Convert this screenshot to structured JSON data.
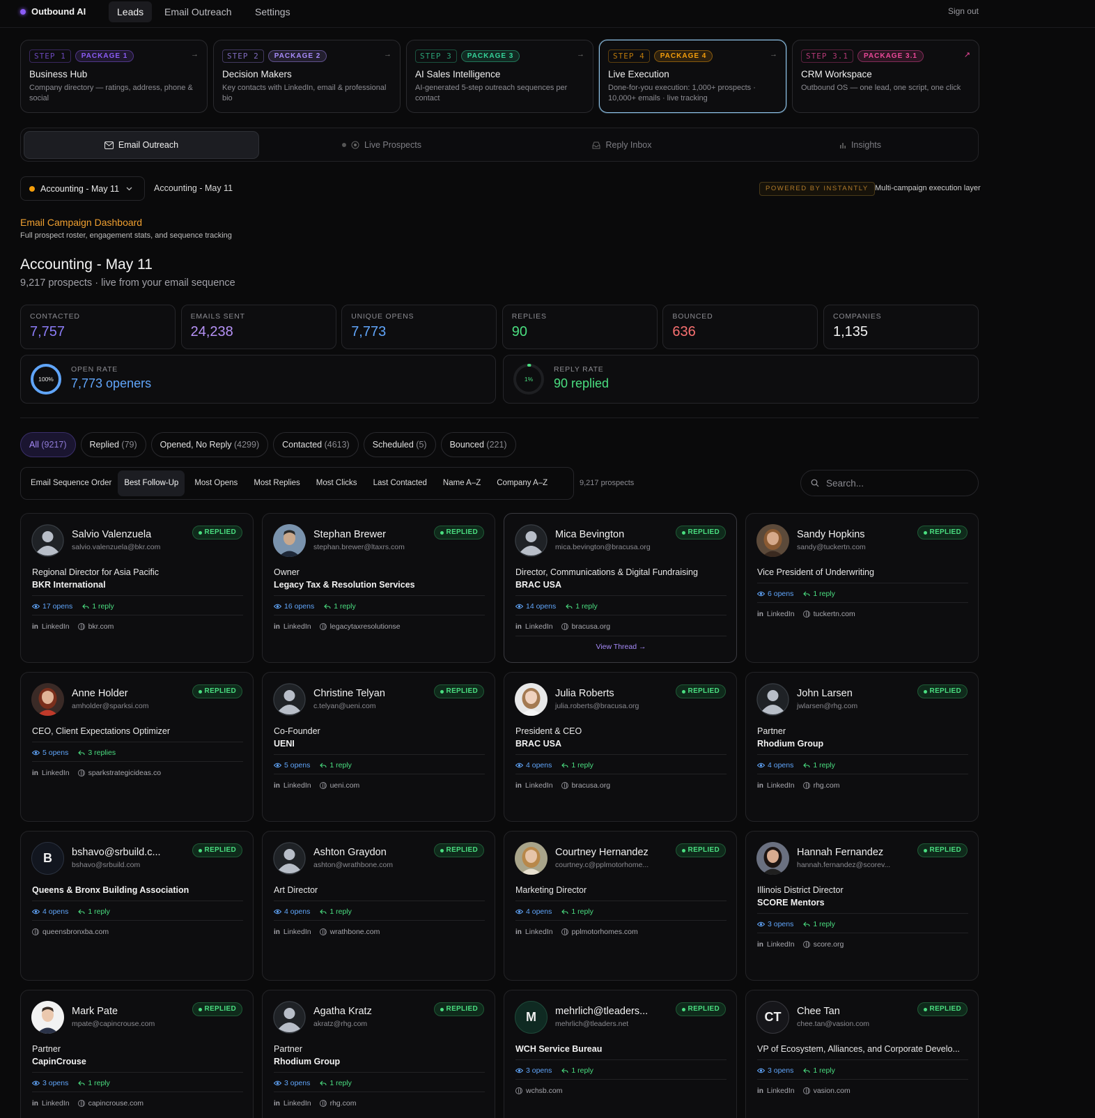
{
  "app": {
    "brand": "Outbound AI",
    "nav": [
      "Leads",
      "Email Outreach",
      "Settings"
    ],
    "sign_out": "Sign out"
  },
  "steps": [
    {
      "step": "STEP 1",
      "package": "PACKAGE 1",
      "title": "Business Hub",
      "desc": "Company directory — ratings, address, phone & social",
      "arrow": "→",
      "color": "#8b5cf6"
    },
    {
      "step": "STEP 2",
      "package": "PACKAGE 2",
      "title": "Decision Makers",
      "desc": "Key contacts with LinkedIn, email & professional bio",
      "arrow": "→",
      "color": "#a78bfa"
    },
    {
      "step": "STEP 3",
      "package": "PACKAGE 3",
      "title": "AI Sales Intelligence",
      "desc": "AI-generated 5-step outreach sequences per contact",
      "arrow": "→",
      "color": "#34d399"
    },
    {
      "step": "STEP 4",
      "package": "PACKAGE 4",
      "title": "Live Execution",
      "desc": "Done-for-you execution: 1,000+ prospects · 10,000+ emails · live tracking",
      "arrow": "→",
      "color": "#f59e0b"
    },
    {
      "step": "STEP 3.1",
      "package": "PACKAGE 3.1",
      "title": "CRM Workspace",
      "desc": "Outbound OS — one lead, one script, one click",
      "arrow": "↗",
      "color": "#ec4899"
    }
  ],
  "subtabs": [
    "Email Outreach",
    "Live Prospects",
    "Reply Inbox",
    "Insights"
  ],
  "campaign": {
    "selected": "Accounting - May 11",
    "label": "Accounting - May 11",
    "powered": "POWERED BY INSTANTLY",
    "multi": "Multi-campaign execution layer",
    "dash_title": "Email Campaign Dashboard",
    "dash_sub": "Full prospect roster, engagement stats, and sequence tracking",
    "heading": "Accounting - May 11",
    "meta": "9,217 prospects · live from your email sequence"
  },
  "stats": [
    {
      "label": "CONTACTED",
      "value": "7,757",
      "color": "#8b7cf6"
    },
    {
      "label": "EMAILS SENT",
      "value": "24,238",
      "color": "#b692f6"
    },
    {
      "label": "UNIQUE OPENS",
      "value": "7,773",
      "color": "#60a5fa"
    },
    {
      "label": "REPLIES",
      "value": "90",
      "color": "#4ade80"
    },
    {
      "label": "BOUNCED",
      "value": "636",
      "color": "#f87171"
    },
    {
      "label": "COMPANIES",
      "value": "1,135",
      "color": "#f2f2f2"
    }
  ],
  "rates": {
    "open": {
      "label": "OPEN RATE",
      "value": "7,773 openers",
      "ring": "100%",
      "fraction": 1.0,
      "color": "#60a5fa"
    },
    "reply": {
      "label": "REPLY RATE",
      "value": "90 replied",
      "ring": "1%",
      "fraction": 0.01,
      "color": "#4ade80"
    }
  },
  "filters": [
    {
      "label": "All",
      "count": "(9217)"
    },
    {
      "label": "Replied",
      "count": "(79)"
    },
    {
      "label": "Opened, No Reply",
      "count": "(4299)"
    },
    {
      "label": "Contacted",
      "count": "(4613)"
    },
    {
      "label": "Scheduled",
      "count": "(5)"
    },
    {
      "label": "Bounced",
      "count": "(221)"
    }
  ],
  "sorts": [
    "Email Sequence Order",
    "Best Follow-Up",
    "Most Opens",
    "Most Replies",
    "Most Clicks",
    "Last Contacted",
    "Name A–Z",
    "Company A–Z"
  ],
  "prospect_count": "9,217 prospects",
  "search_placeholder": "Search...",
  "badge": "REPLIED",
  "linkedin_label": "LinkedIn",
  "view_thread": "View Thread →",
  "leads": [
    {
      "name": "Salvio Valenzuela",
      "email": "salvio.valenzuela@bkr.com",
      "title": "Regional Director for Asia Pacific",
      "company": "BKR International",
      "opens": "17 opens",
      "replies": "1 reply",
      "linkedin": true,
      "site": "bkr.com",
      "avatar": "generic"
    },
    {
      "name": "Stephan Brewer",
      "email": "stephan.brewer@ltaxrs.com",
      "title": "Owner",
      "company": "Legacy Tax & Resolution Services",
      "opens": "16 opens",
      "replies": "1 reply",
      "linkedin": true,
      "site": "legacytaxresolutionse",
      "avatar": "photo-suit"
    },
    {
      "name": "Mica Bevington",
      "email": "mica.bevington@bracusa.org",
      "title": "Director, Communications & Digital Fundraising",
      "company": "BRAC USA",
      "opens": "14 opens",
      "replies": "1 reply",
      "linkedin": true,
      "site": "bracusa.org",
      "avatar": "generic",
      "thread": true
    },
    {
      "name": "Sandy Hopkins",
      "email": "sandy@tuckertn.com",
      "title": "Vice President of Underwriting",
      "company": "",
      "opens": "6 opens",
      "replies": "1 reply",
      "linkedin": true,
      "site": "tuckertn.com",
      "avatar": "photo-woman-older"
    },
    {
      "name": "Anne Holder",
      "email": "amholder@sparksi.com",
      "title": "CEO, Client Expectations Optimizer",
      "company": "",
      "opens": "5 opens",
      "replies": "3 replies",
      "linkedin": true,
      "site": "sparkstrategicideas.co",
      "avatar": "photo-woman-red"
    },
    {
      "name": "Christine Telyan",
      "email": "c.telyan@ueni.com",
      "title": "Co-Founder",
      "company": "UENI",
      "opens": "5 opens",
      "replies": "1 reply",
      "linkedin": true,
      "site": "ueni.com",
      "avatar": "generic"
    },
    {
      "name": "Julia Roberts",
      "email": "julia.roberts@bracusa.org",
      "title": "President & CEO",
      "company": "BRAC USA",
      "opens": "4 opens",
      "replies": "1 reply",
      "linkedin": true,
      "site": "bracusa.org",
      "avatar": "photo-woman-light"
    },
    {
      "name": "John Larsen",
      "email": "jwlarsen@rhg.com",
      "title": "Partner",
      "company": "Rhodium Group",
      "opens": "4 opens",
      "replies": "1 reply",
      "linkedin": true,
      "site": "rhg.com",
      "avatar": "generic"
    },
    {
      "name": "bshavo@srbuild.c...",
      "email": "bshavo@srbuild.com",
      "title": "",
      "company": "Queens & Bronx Building Association",
      "opens": "4 opens",
      "replies": "1 reply",
      "linkedin": false,
      "site": "queensbronxba.com",
      "avatar": "B"
    },
    {
      "name": "Ashton Graydon",
      "email": "ashton@wrathbone.com",
      "title": "Art Director",
      "company": "",
      "opens": "4 opens",
      "replies": "1 reply",
      "linkedin": true,
      "site": "wrathbone.com",
      "avatar": "generic"
    },
    {
      "name": "Courtney Hernandez",
      "email": "courtney.c@pplmotorhome...",
      "title": "Marketing Director",
      "company": "",
      "opens": "4 opens",
      "replies": "1 reply",
      "linkedin": true,
      "site": "pplmotorhomes.com",
      "avatar": "photo-woman-blond"
    },
    {
      "name": "Hannah Fernandez",
      "email": "hannah.fernandez@scorev...",
      "title": "Illinois District Director",
      "company": "SCORE Mentors",
      "opens": "3 opens",
      "replies": "1 reply",
      "linkedin": true,
      "site": "score.org",
      "avatar": "photo-woman-dark"
    },
    {
      "name": "Mark Pate",
      "email": "mpate@capincrouse.com",
      "title": "Partner",
      "company": "CapinCrouse",
      "opens": "3 opens",
      "replies": "1 reply",
      "linkedin": true,
      "site": "capincrouse.com",
      "avatar": "photo-man-white"
    },
    {
      "name": "Agatha Kratz",
      "email": "akratz@rhg.com",
      "title": "Partner",
      "company": "Rhodium Group",
      "opens": "3 opens",
      "replies": "1 reply",
      "linkedin": true,
      "site": "rhg.com",
      "avatar": "generic"
    },
    {
      "name": "mehrlich@tleaders...",
      "email": "mehrlich@tleaders.net",
      "title": "",
      "company": "WCH Service Bureau",
      "opens": "3 opens",
      "replies": "1 reply",
      "linkedin": false,
      "site": "wchsb.com",
      "avatar": "M"
    },
    {
      "name": "Chee Tan",
      "email": "chee.tan@vasion.com",
      "title": "VP of Ecosystem, Alliances, and Corporate Develo...",
      "company": "",
      "opens": "3 opens",
      "replies": "1 reply",
      "linkedin": true,
      "site": "vasion.com",
      "avatar": "CT"
    }
  ]
}
